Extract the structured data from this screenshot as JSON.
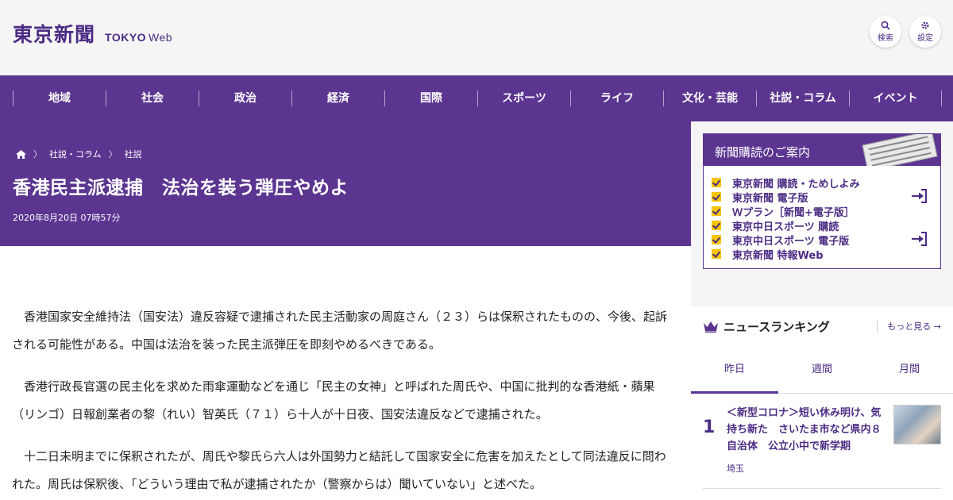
{
  "header": {
    "logo_jp": "東京新聞",
    "logo_en_bold": "TOKYO",
    "logo_en_light": "Web",
    "search_label": "検索",
    "settings_label": "設定"
  },
  "nav": [
    "地域",
    "社会",
    "政治",
    "経済",
    "国際",
    "スポーツ",
    "ライフ",
    "文化・芸能",
    "社説・コラム",
    "イベント"
  ],
  "breadcrumb": {
    "items": [
      "社説・コラム",
      "社説"
    ]
  },
  "article": {
    "title": "香港民主派逮捕　法治を装う弾圧やめよ",
    "date": "2020年8月20日 07時57分",
    "paragraphs": [
      "香港国家安全維持法（国安法）違反容疑で逮捕された民主活動家の周庭さん（２３）らは保釈されたものの、今後、起訴される可能性がある。中国は法治を装った民主派弾圧を即刻やめるべきである。",
      "香港行政長官選の民主化を求めた雨傘運動などを通じ「民主の女神」と呼ばれた周氏や、中国に批判的な香港紙・蘋果（リンゴ）日報創業者の黎（れい）智英氏（７１）ら十人が十日夜、国安法違反などで逮捕された。",
      "十二日未明までに保釈されたが、周氏や黎氏ら六人は外国勢力と結託して国家安全に危害を加えたとして同法違反に問われた。周氏は保釈後、「どういう理由で私が逮捕されたか（警察からは）聞いていない」と述べた。"
    ]
  },
  "subscription": {
    "title": "新聞購読のご案内",
    "items": [
      "東京新聞 購読・ためしよみ",
      "東京新聞 電子版",
      "Ｗプラン［新聞+電子版］",
      "東京中日スポーツ 購読",
      "東京中日スポーツ 電子版",
      "東京新聞 特報Web"
    ]
  },
  "ranking": {
    "title": "ニュースランキング",
    "more": "もっと見る",
    "tabs": [
      "昨日",
      "週間",
      "月間"
    ],
    "items": [
      {
        "rank": "1",
        "headline": "＜新型コロナ＞短い休み明け、気持ち新た　さいたま市など県内８自治体　公立小中で新学期",
        "category": "埼玉"
      }
    ]
  },
  "colors": {
    "brand": "#5b3590",
    "accent": "#f5c500"
  }
}
